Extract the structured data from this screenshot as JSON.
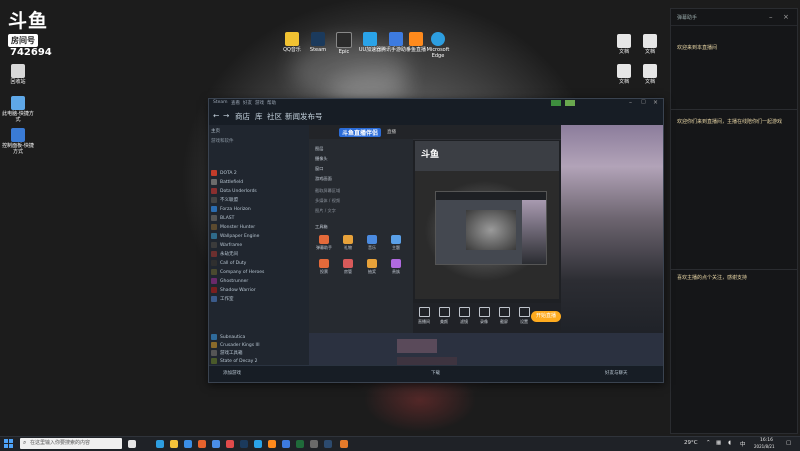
{
  "overlay": {
    "logo_text": "斗鱼",
    "room_label": "房间号",
    "room_number": "742694"
  },
  "desktop_icons": [
    {
      "label": "回收站",
      "color": "#d8d8d8"
    },
    {
      "label": "此电脑-快捷方式",
      "color": "#5fa8e8"
    },
    {
      "label": "控制面板-快捷方式",
      "color": "#3a7bd5"
    },
    {
      "label": "QQ音乐",
      "color": "#f1c232"
    },
    {
      "label": "Steam",
      "color": "#1b3a5c"
    },
    {
      "label": "Epic",
      "color": "#2b2b2b"
    },
    {
      "label": "UU加速器",
      "color": "#2aa3e8"
    },
    {
      "label": "腾讯手游助手",
      "color": "#3d7be0"
    },
    {
      "label": "斗鱼直播",
      "color": "#ff8a1c"
    },
    {
      "label": "Microsoft Edge",
      "color": "#2d9ee0"
    },
    {
      "label": "文档",
      "color": "#e6e6e6"
    },
    {
      "label": "文档",
      "color": "#e6e6e6"
    },
    {
      "label": "文档",
      "color": "#e6e6e6"
    },
    {
      "label": "文档",
      "color": "#e6e6e6"
    }
  ],
  "chat": {
    "title": "弹幕助手",
    "messages": [
      "欢迎来到本直播间",
      "欢迎你们来到直播间，主播在线陪你们一起游戏",
      "喜欢主播的点个关注，感谢支持"
    ]
  },
  "steam": {
    "title_menu": [
      "Steam",
      "查看",
      "好友",
      "游戏",
      "帮助"
    ],
    "nav": [
      "商店",
      "库",
      "社区",
      "新闻发布号"
    ],
    "sidebar_header": "主页",
    "sidebar_sub": "游戏和软件",
    "games": [
      {
        "name": "DOTA 2",
        "color": "#c23c2a"
      },
      {
        "name": "Battlefield",
        "color": "#6b6b6b"
      },
      {
        "name": "Dota Underlords",
        "color": "#8a2f2f"
      },
      {
        "name": "不义联盟",
        "color": "#444"
      },
      {
        "name": "Forza Horizon",
        "color": "#2b6cb0"
      },
      {
        "name": "BLAST",
        "color": "#555"
      },
      {
        "name": "Monster Hunter",
        "color": "#5b4a2f"
      },
      {
        "name": "Wallpaper Engine",
        "color": "#2f6b8a"
      },
      {
        "name": "Warframe",
        "color": "#3b3b3b"
      },
      {
        "name": "永劫无间",
        "color": "#6b2f2f"
      },
      {
        "name": "Call of Duty",
        "color": "#2f2f2f"
      },
      {
        "name": "Company of Heroes",
        "color": "#4a4a2f"
      },
      {
        "name": "Ghostrunner",
        "color": "#6a2a6a"
      },
      {
        "name": "Shadow Warrior",
        "color": "#7a1f1f"
      },
      {
        "name": "工作室",
        "color": "#3b5b8b"
      },
      {
        "name": "Subnautica",
        "color": "#2f6b9b"
      },
      {
        "name": "Crusader Kings III",
        "color": "#8a6a2a"
      },
      {
        "name": "游戏工具箱",
        "color": "#555"
      },
      {
        "name": "State of Decay 2",
        "color": "#4a5a2a"
      }
    ],
    "add_game": "添加游戏",
    "downloads": "下载",
    "friends": "好友与聊天"
  },
  "douyu_app": {
    "logo": "斗鱼直播伴侣",
    "tab_live": "直播",
    "menu_items": [
      "图层",
      "摄像头",
      "窗口",
      "游戏画面",
      "截取屏幕区域",
      "多媒体 / 视频",
      "图片 / 文字",
      "工具箱"
    ],
    "tools": [
      "弹幕助手",
      "礼物",
      "音乐",
      "主题",
      "投票",
      "房管",
      "抽奖",
      "贵族"
    ],
    "controls": [
      "直播间",
      "美颜",
      "滤镜",
      "录像",
      "截屏",
      "设置"
    ],
    "go_live": "开始直播",
    "preview_logo": "斗鱼"
  },
  "taskbar": {
    "search_placeholder": "在这里输入你要搜索的内容",
    "weather": "29°C",
    "time": "16:16",
    "date": "2021/8/21"
  }
}
